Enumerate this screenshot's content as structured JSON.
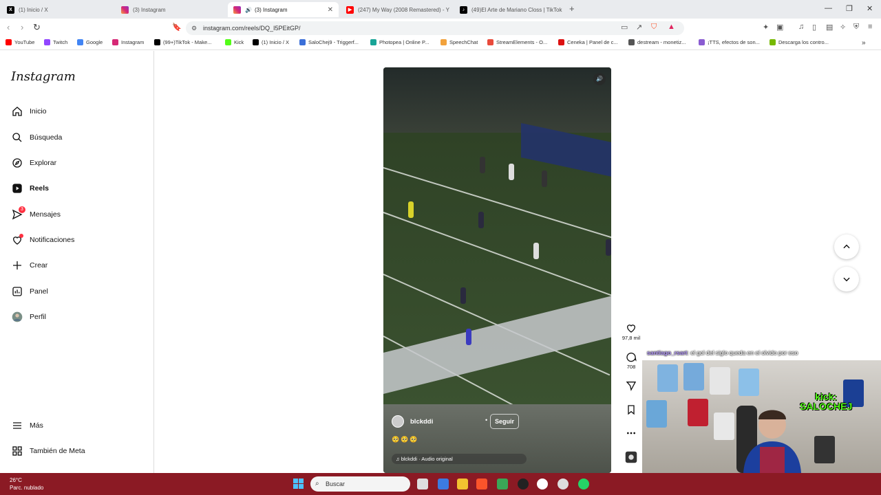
{
  "browser": {
    "tabs": [
      {
        "title": "(1) Inicio / X",
        "icon": "x-icon"
      },
      {
        "title": "(3) Instagram",
        "icon": "instagram-icon"
      },
      {
        "title": "(3) Instagram",
        "icon": "instagram-icon",
        "active": true
      },
      {
        "title": "(247) My Way (2008 Remastered) - Y",
        "icon": "youtube-icon"
      },
      {
        "title": "(49)El Arte de Mariano Closs | TikTok",
        "icon": "tiktok-icon"
      }
    ],
    "url": "instagram.com/reels/DQ_I5PEitGP/",
    "bookmarks": [
      "YouTube",
      "Twitch",
      "Google",
      "Instagram",
      "(99+)TikTok - Make...",
      "Kick",
      "(1) Inicio / X",
      "SaloChej9 - Triggerf...",
      "Photopea | Online P...",
      "SpeechChat",
      "StreamElements - O...",
      "Ceneka | Panel de c...",
      "destream - monetiz...",
      "¡TTS, efectos de son...",
      "Descarga los contro..."
    ]
  },
  "sidebar": {
    "logo": "Instagram",
    "items": [
      {
        "label": "Inicio",
        "icon": "home-icon"
      },
      {
        "label": "Búsqueda",
        "icon": "search-icon"
      },
      {
        "label": "Explorar",
        "icon": "compass-icon"
      },
      {
        "label": "Reels",
        "icon": "reels-icon"
      },
      {
        "label": "Mensajes",
        "icon": "messages-icon",
        "badge": "3"
      },
      {
        "label": "Notificaciones",
        "icon": "heart-icon"
      },
      {
        "label": "Crear",
        "icon": "plus-icon"
      },
      {
        "label": "Panel",
        "icon": "dashboard-icon"
      },
      {
        "label": "Perfil",
        "icon": "avatar"
      }
    ],
    "bottom": [
      {
        "label": "Más",
        "icon": "menu-icon"
      },
      {
        "label": "También de Meta",
        "icon": "meta-icon"
      }
    ]
  },
  "reel": {
    "username": "blckddi",
    "follow_label": "Seguir",
    "emojis": "🥺🥺🥺",
    "audio": "♫ blckddi · Audio original",
    "likes": "97,8 mil",
    "comments": "708"
  },
  "overlay": {
    "chat_user": "santiago_rsart",
    "chat_text": ": el gol del siglo queda en el olvido por eso",
    "kick_label": "kick:",
    "kick_name": "SALOCHEJ"
  },
  "taskbar": {
    "temp": "26°C",
    "weather": "Parc. nublado",
    "search_placeholder": "Buscar"
  },
  "colors": {
    "taskbar": "#8b1a24",
    "notification_badge": "#ff3040",
    "kick_green": "#53fc18"
  }
}
